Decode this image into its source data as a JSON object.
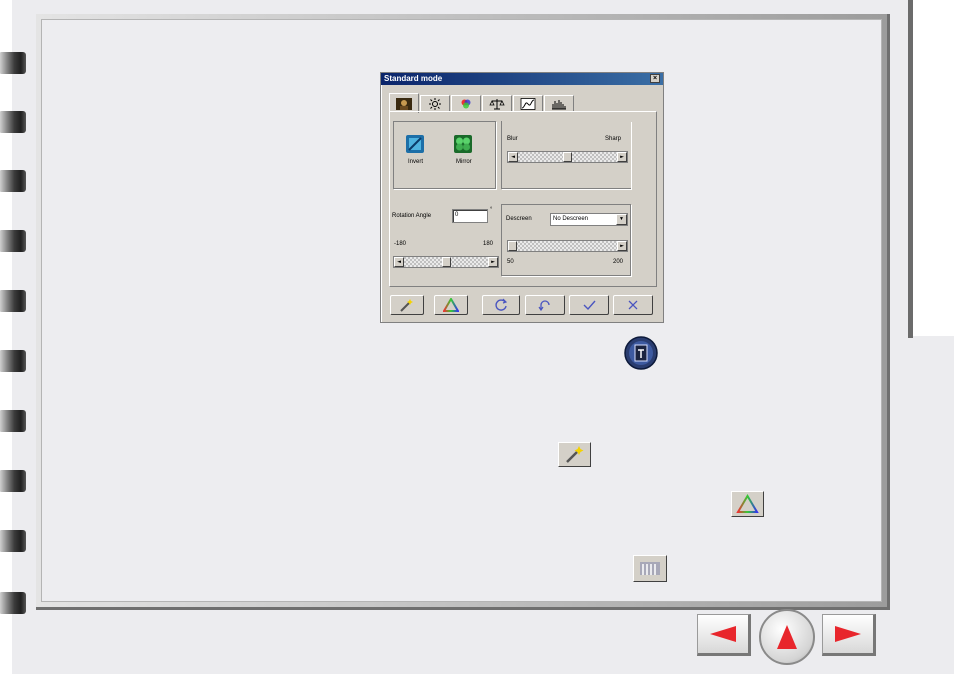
{
  "dialog": {
    "title": "Standard mode",
    "close_label": "×",
    "tabs": [
      "image-tab",
      "brightness-tab",
      "color-tab",
      "balance-tab",
      "curve-tab",
      "histogram-tab"
    ],
    "tools": {
      "invert_label": "Invert",
      "mirror_label": "Mirror"
    },
    "sharpness": {
      "left_label": "Blur",
      "right_label": "Sharp",
      "value_fraction": 0.5
    },
    "rotation": {
      "label": "Rotation Angle",
      "value": "0",
      "unit": "°",
      "min_label": "-180",
      "max_label": "180",
      "value_fraction": 0.5
    },
    "descreen": {
      "label": "Descreen",
      "selected": "No Descreen",
      "min_label": "50",
      "max_label": "200",
      "value_fraction": 0.0
    },
    "arrow_left": "◄",
    "arrow_right": "►",
    "dropdown_arrow": "▼"
  },
  "colors": {
    "title_start": "#0a246a",
    "title_end": "#3a6ea5",
    "dialog_bg": "#d4d0c8",
    "nav_arrow": "#e8262c"
  }
}
